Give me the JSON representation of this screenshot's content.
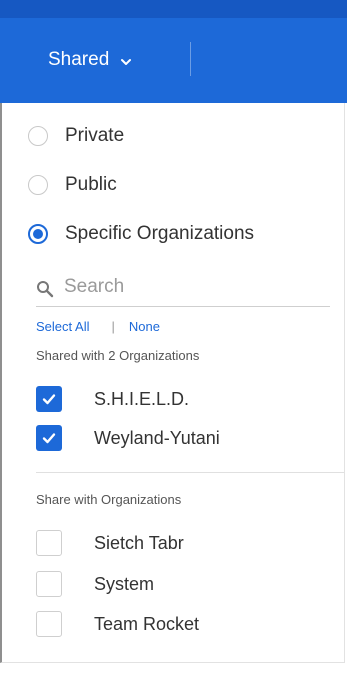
{
  "header": {
    "shared_label": "Shared"
  },
  "visibility": {
    "options": [
      {
        "label": "Private",
        "selected": false
      },
      {
        "label": "Public",
        "selected": false
      },
      {
        "label": "Specific Organizations",
        "selected": true
      }
    ]
  },
  "search": {
    "placeholder": "Search",
    "value": ""
  },
  "bulk_actions": {
    "select_all": "Select All",
    "separator": "|",
    "none": "None"
  },
  "shared_section": {
    "title": "Shared with 2 Organizations",
    "items": [
      {
        "label": "S.H.I.E.L.D.",
        "checked": true
      },
      {
        "label": "Weyland-Yutani",
        "checked": true
      }
    ]
  },
  "share_section": {
    "title": "Share with Organizations",
    "items": [
      {
        "label": "Sietch Tabr",
        "checked": false
      },
      {
        "label": "System",
        "checked": false
      },
      {
        "label": "Team Rocket",
        "checked": false
      }
    ]
  },
  "colors": {
    "accent": "#1d69d8",
    "header_bg": "#1d69d8"
  }
}
